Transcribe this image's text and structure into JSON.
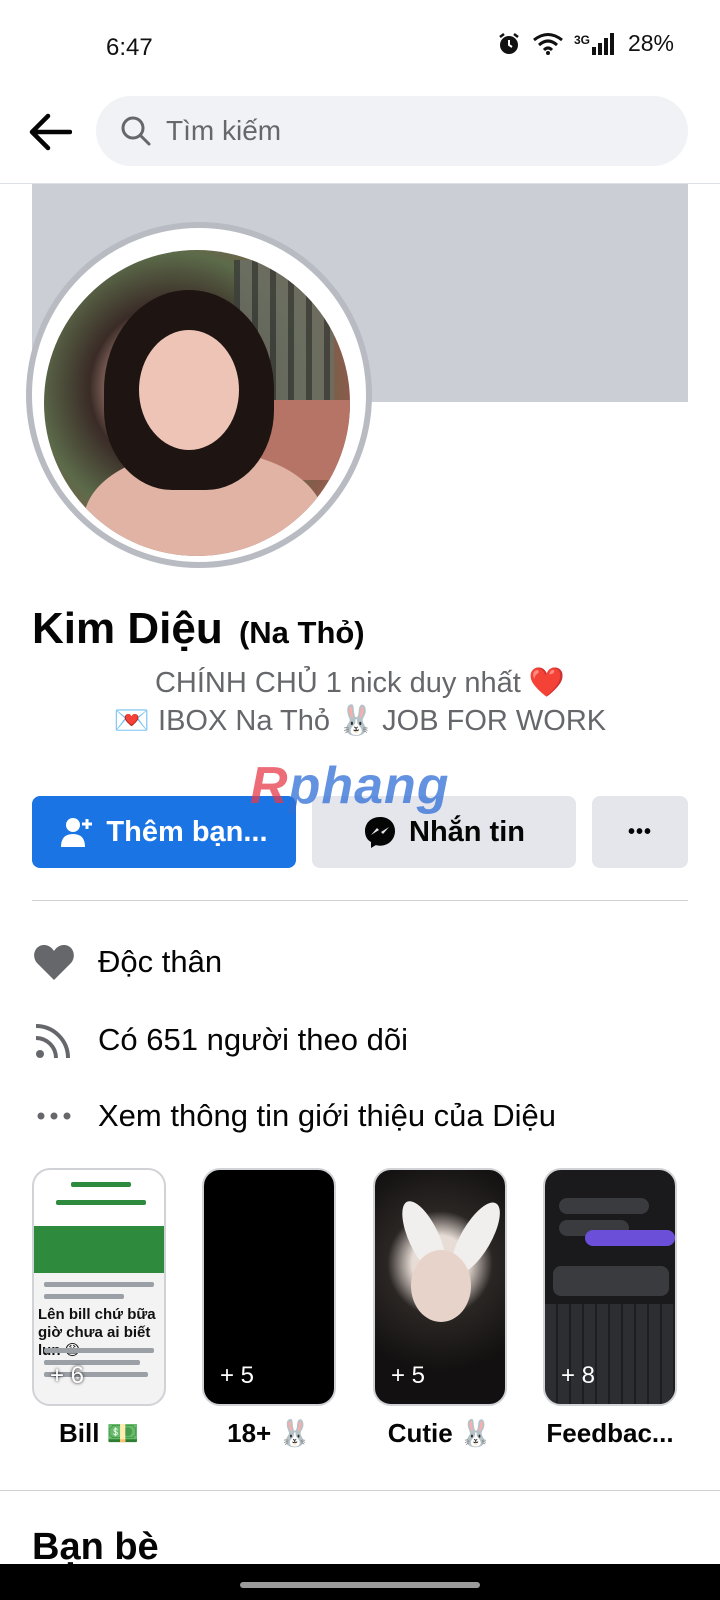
{
  "status_bar": {
    "time": "6:47",
    "network": "3G",
    "battery": "28%"
  },
  "search": {
    "placeholder": "Tìm kiếm"
  },
  "profile": {
    "name": "Kim Diệu",
    "nickname": "(Na Thỏ)",
    "bio_line1": "CHÍNH CHỦ 1 nick duy nhất ❤️",
    "bio_line2": "💌 IBOX Na Thỏ 🐰 JOB FOR WORK"
  },
  "watermark": {
    "part1": "R",
    "part2": "phang"
  },
  "actions": {
    "add_friend": "Thêm bạn...",
    "message": "Nhắn tin",
    "more": "•••"
  },
  "info": {
    "relationship": "Độc thân",
    "followers": "Có 651 người theo dõi",
    "about": "Xem thông tin giới thiệu của Diệu"
  },
  "highlights": [
    {
      "label": "Bill 💵",
      "count": "+ 6"
    },
    {
      "label": "18+ 🐰",
      "count": "+ 5"
    },
    {
      "label": "Cutie 🐰",
      "count": "+ 5"
    },
    {
      "label": "Feedbac...",
      "count": "+ 8"
    }
  ],
  "highlight_texts": {
    "bill_big": "Lên bill chứ bữa giờ chưa ai biết lun 😩"
  },
  "friends": {
    "title": "Bạn bè"
  },
  "colors": {
    "accent": "#1b74e4",
    "secondary_button": "#e4e6eb",
    "cover": "#cbcfd5",
    "muted_text": "#65676b"
  },
  "icons": {
    "back": "arrow-left-icon",
    "search": "search-icon",
    "add_friend": "person-add-icon",
    "message": "messenger-icon",
    "relationship": "heart-icon",
    "followers": "rss-icon",
    "about": "ellipsis-icon"
  }
}
